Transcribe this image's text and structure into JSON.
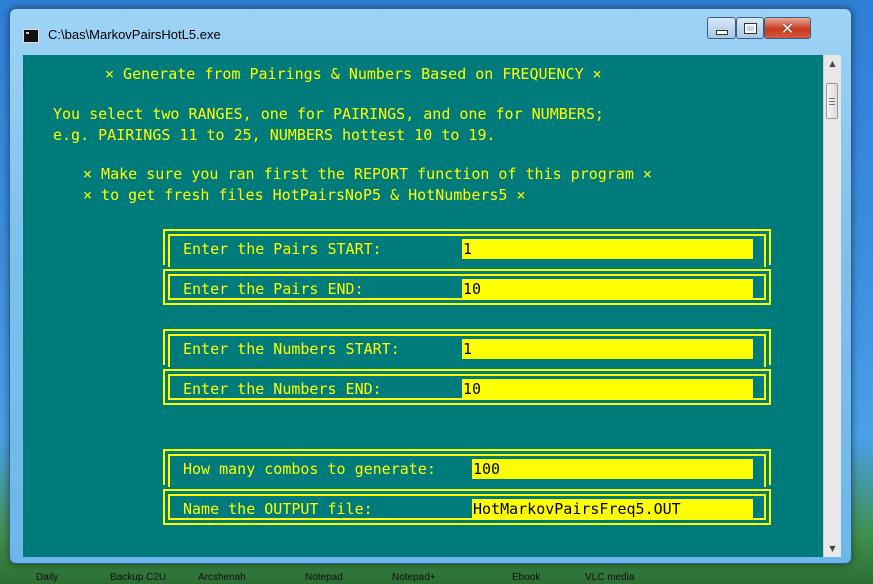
{
  "window": {
    "title": "C:\\bas\\MarkovPairsHotL5.exe"
  },
  "controls": {
    "close_glyph": "✕"
  },
  "console": {
    "header": "× Generate from Pairings & Numbers Based on FREQUENCY ×",
    "intro_line1": "You select two RANGES, one for PAIRINGS, and one for NUMBERS;",
    "intro_line2": "e.g. PAIRINGS 11 to 25, NUMBERS hottest 10 to 19.",
    "note_line1": "× Make sure you ran first the REPORT function of this program ×",
    "note_line2": "× to get fresh files HotPairsNoP5 & HotNumbers5 ×"
  },
  "form": {
    "pairs_start": {
      "label": "Enter the Pairs START:",
      "value": "1"
    },
    "pairs_end": {
      "label": "Enter the Pairs END:",
      "value": "10"
    },
    "numbers_start": {
      "label": "Enter the Numbers START:",
      "value": "1"
    },
    "numbers_end": {
      "label": "Enter the Numbers END:",
      "value": "10"
    },
    "combos": {
      "label": "How many combos to generate:",
      "value": "100"
    },
    "output_file": {
      "label": "Name the OUTPUT file:",
      "value": "HotMarkovPairsFreq5.OUT"
    }
  },
  "desktop_labels": [
    "Daily",
    "Backup C2U",
    "Arcshenah",
    "Notepad",
    "Notepad+",
    "Ebook",
    "VLC media"
  ]
}
